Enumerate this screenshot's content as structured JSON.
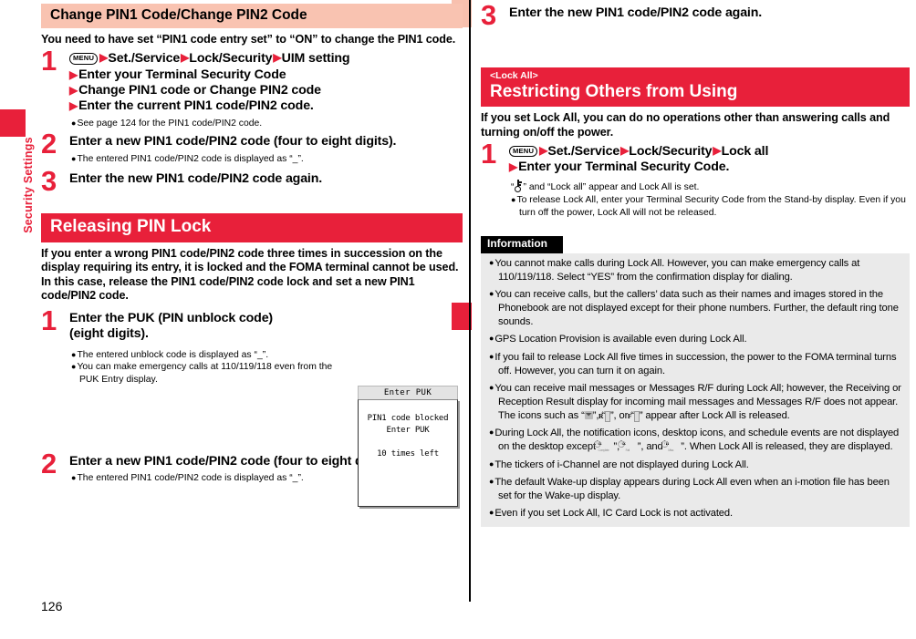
{
  "page": {
    "number": "126",
    "side_tab_label": "Security Settings",
    "colors": {
      "accent_red": "#e8203a",
      "heading_peach": "#f9c3b1",
      "info_bg": "#eaeaea"
    }
  },
  "left_column": {
    "section1": {
      "heading": "Change PIN1 Code/Change PIN2 Code",
      "intro": "You need to have set “PIN1 code entry set” to “ON” to change the PIN1 code.",
      "steps": [
        {
          "num": "1",
          "menu_key": "MENU",
          "title_lines": [
            "Set./Service▶Lock/Security▶UIM setting",
            "▶Enter your Terminal Security Code",
            "▶Change PIN1 code or Change PIN2 code",
            "▶Enter the current PIN1 code/PIN2 code."
          ],
          "notes": [
            "See page 124 for the PIN1 code/PIN2 code."
          ]
        },
        {
          "num": "2",
          "title_lines": [
            "Enter a new PIN1 code/PIN2 code (four to eight digits)."
          ],
          "notes": [
            "The entered PIN1 code/PIN2 code is displayed as “_”."
          ]
        },
        {
          "num": "3",
          "title_lines": [
            "Enter the new PIN1 code/PIN2 code again."
          ],
          "notes": []
        }
      ]
    },
    "section2": {
      "heading": "Releasing PIN Lock",
      "intro": "If you enter a wrong PIN1 code/PIN2 code three times in succession on the display requiring its entry, it is locked and the FOMA terminal cannot be used. In this case, release the PIN1 code/PIN2 code lock and set a new PIN1 code/PIN2 code.",
      "steps": [
        {
          "num": "1",
          "title_lines": [
            "Enter the PUK (PIN unblock code)",
            "(eight digits)."
          ],
          "notes": [
            "The entered unblock code is displayed as “_”.",
            "You can make emergency calls at 110/119/118 even from the PUK Entry display."
          ]
        },
        {
          "num": "2",
          "title_lines": [
            "Enter a new PIN1 code/PIN2 code (four to eight digits)."
          ],
          "notes": [
            "The entered PIN1 code/PIN2 code is displayed as “_”."
          ]
        }
      ],
      "phone_mock": {
        "title": "Enter PUK",
        "line1": "PIN1 code blocked",
        "line2": "Enter PUK",
        "line3": "10 times left"
      }
    }
  },
  "right_column": {
    "step3": {
      "num": "3",
      "title_lines": [
        "Enter the new PIN1 code/PIN2 code again."
      ]
    },
    "section": {
      "kicker": "<Lock All>",
      "heading": "Restricting Others from Using",
      "intro": "If you set Lock All, you can do no operations other than answering calls and turning on/off the power.",
      "step": {
        "num": "1",
        "menu_key": "MENU",
        "title_lines": [
          "Set./Service▶Lock/Security▶Lock all",
          "▶Enter your Terminal Security Code."
        ],
        "notes_plain": "” and “Lock all” appear and Lock All is set.",
        "notes": [
          "To release Lock All, enter your Terminal Security Code from the Stand-by display. Even if you turn off the power, Lock All will not be released."
        ]
      }
    },
    "information": {
      "title": "Information",
      "items": [
        {
          "id": "info-calls",
          "text": "You cannot make calls during Lock All. However, you can make emergency calls at 110/119/118. Select “YES” from the confirmation display for dialing."
        },
        {
          "id": "info-receive-calls",
          "text": "You can receive calls, but the callers’ data such as their names and images stored in the Phonebook are not displayed except for their phone numbers. Further, the default ring tone sounds."
        },
        {
          "id": "info-gps",
          "text": "GPS Location Provision is available even during Lock All."
        },
        {
          "id": "info-fail-release",
          "text": "If you fail to release Lock All five times in succession, the power to the FOMA terminal turns off. However, you can turn it on again."
        },
        {
          "id": "info-mail",
          "text_part1": "You can receive mail messages or Messages R/F during Lock All; however, the Receiving or Reception Result display for incoming mail messages and Messages R/F does not appear. The icons such as “",
          "icon1": "mail-icon",
          "text_part2": "”, “",
          "icon2": "R",
          "text_part3": "”, or “",
          "icon3": "F",
          "text_part4": "” appear after Lock All is released."
        },
        {
          "id": "info-desktop-icons",
          "text_part1": "During Lock All, the notification icons, desktop icons, and schedule events are not displayed on the desktop except “",
          "icon1_label": "Complete",
          "text_part2": "”, “",
          "icon2_label": "Fail",
          "text_part3": "”, and “",
          "icon3_label": "Miss",
          "text_part4": "”. When Lock All is released, they are displayed."
        },
        {
          "id": "info-ichannel",
          "text": "The tickers of i-Channel are not displayed during Lock All."
        },
        {
          "id": "info-wakeup",
          "text": "The default Wake-up display appears during Lock All even when an i-motion file has been set for the Wake-up display."
        },
        {
          "id": "info-ic-card",
          "text": "Even if you set Lock All, IC Card Lock is not activated."
        }
      ]
    }
  }
}
